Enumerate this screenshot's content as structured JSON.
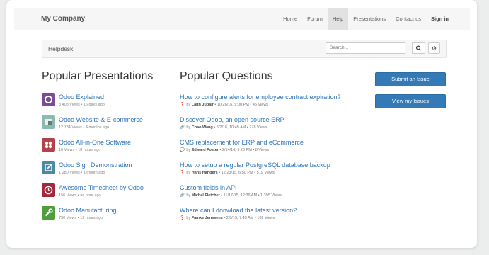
{
  "navbar": {
    "brand": "My Company",
    "items": [
      {
        "label": "Home"
      },
      {
        "label": "Forum"
      },
      {
        "label": "Help"
      },
      {
        "label": "Presentations"
      },
      {
        "label": "Contact us"
      },
      {
        "label": "Sign in"
      }
    ],
    "active": "Help"
  },
  "helpdesk": {
    "title": "Helpdesk",
    "search_placeholder": "Search..."
  },
  "presentations": {
    "heading": "Popular Presentations",
    "items": [
      {
        "title": "Odoo Explained",
        "meta": "3 408 Views • 16 days ago",
        "icon": "odoo-circle-icon",
        "color": "#7d4d93"
      },
      {
        "title": "Odoo Website & E-commerce",
        "meta": "12 784 Views • 4 months ago",
        "icon": "website-icon",
        "color": "#8fb9b0"
      },
      {
        "title": "Odoo All-in-One Software",
        "meta": "16 Views • 18 hours ago",
        "icon": "apps-icon",
        "color": "#b4424b"
      },
      {
        "title": "Odoo Sign Demonstration",
        "meta": "1 280 Views • 1 month ago",
        "icon": "sign-icon",
        "color": "#4c8aa1"
      },
      {
        "title": "Awesome Timesheet by Odoo",
        "meta": "156 Views • an hour ago",
        "icon": "timesheet-icon",
        "color": "#a4273c"
      },
      {
        "title": "Odoo Manufacturing",
        "meta": "730 Views • 12 hours ago",
        "icon": "wrench-icon",
        "color": "#4f9e3b"
      }
    ]
  },
  "questions": {
    "heading": "Popular Questions",
    "items": [
      {
        "title": "How to configure alerts for employee contract expiration?",
        "icon": "question-icon",
        "by": "by",
        "author": "Laith Jubair",
        "rest": " • 10/26/16, 9:00 PM • 45 Views"
      },
      {
        "title": "Discover Odoo, an open source ERP",
        "icon": "link-icon",
        "by": "by",
        "author": "Chao Wang",
        "rest": " • 8/2/16, 10:45 AM • 278 Views"
      },
      {
        "title": "CMS replacement for ERP and eCommerce",
        "icon": "comment-icon",
        "by": "by",
        "author": "Edward Foster",
        "rest": " • 2/14/16, 9:20 PM • 8 Views"
      },
      {
        "title": "How to setup a regular PostgreSQL database backup",
        "icon": "question-icon",
        "by": "by",
        "author": "Hans Handers",
        "rest": " • 12/23/15, 6:50 PM • 519 Views"
      },
      {
        "title": "Custom fields in API",
        "icon": "link-icon",
        "by": "by",
        "author": "Michel Fletcher",
        "rest": " • 11/17/15, 12:36 AM • 1 395 Views"
      },
      {
        "title": "Where can I donwload the latest version?",
        "icon": "question-icon",
        "by": "by",
        "author": "Famke Jenssens",
        "rest": " • 2/8/15, 7:45 AM • 102 Views"
      }
    ]
  },
  "actions": {
    "submit_label": "Submit an Issue",
    "view_label": "View my Issues"
  },
  "colors": {
    "link": "#2c73b8",
    "primary_button": "#337ab7"
  }
}
